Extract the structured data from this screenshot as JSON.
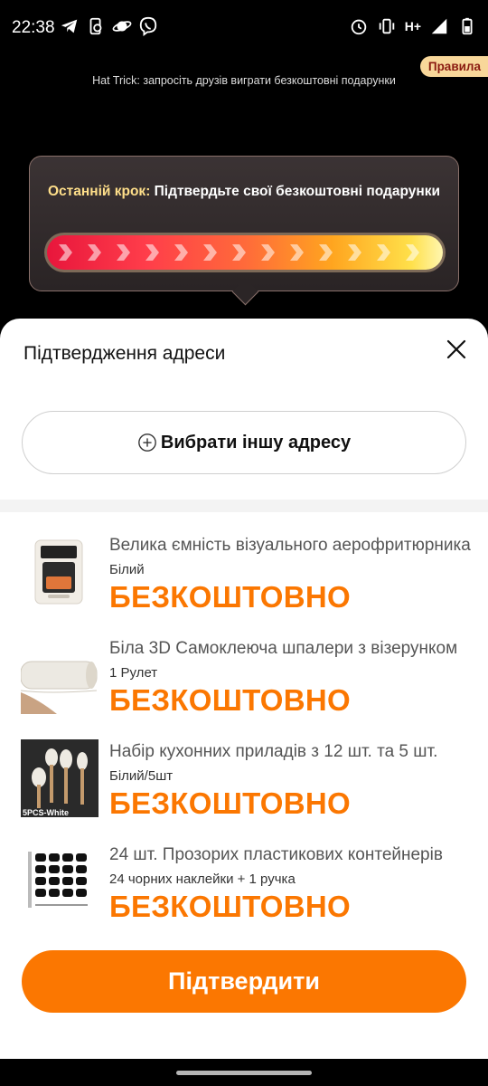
{
  "status_bar": {
    "time": "22:38",
    "left_icons": [
      "telegram-icon",
      "phone-sync-icon",
      "planet-icon",
      "viber-icon"
    ],
    "right_icons": [
      "alarm-icon",
      "vibrate-icon",
      "network-icon",
      "signal-icon",
      "battery-icon"
    ],
    "network_label": "H+"
  },
  "promo": {
    "text": "Hat Trick: запросіть друзів виграти безкоштовні подарунки",
    "rules_label": "Правила"
  },
  "progress": {
    "title_accent": "Останній крок:",
    "title_text": " Підтвердьте свої безкоштовні подарунки",
    "fraction": 1.0,
    "colors": {
      "start": "#e8163c",
      "mid": "#ffa51f",
      "end": "#fff6b0"
    }
  },
  "sheet": {
    "title": "Підтвердження адреси",
    "alt_address_label": "Вибрати іншу адресу",
    "confirm_label": "Підтвердити"
  },
  "items": [
    {
      "title": "Велика ємність візуального аерофритюрника",
      "variant": "Білий",
      "price": "БЕЗКОШТОВНО",
      "icon": "air-fryer-image"
    },
    {
      "title": "Біла 3D Самоклеюча шпалери з візерунком",
      "variant": "1 Рулет",
      "price": "БЕЗКОШТОВНО",
      "icon": "wallpaper-roll-image"
    },
    {
      "title": "Набір кухонних приладів з 12 шт. та 5 шт.",
      "variant": "Білий/5шт",
      "price": "БЕЗКОШТОВНО",
      "icon": "kitchen-utensils-image",
      "thumb_caption": "5PCS-White"
    },
    {
      "title": "24 шт. Прозорих пластикових контейнерів",
      "variant": "24 чорних наклейки + 1 ручка",
      "price": "БЕЗКОШТОВНО",
      "icon": "labels-sheet-image"
    }
  ],
  "colors": {
    "accent": "#fb7701",
    "gold": "#ffdf8a",
    "rules_bg": "#f8d79a"
  }
}
